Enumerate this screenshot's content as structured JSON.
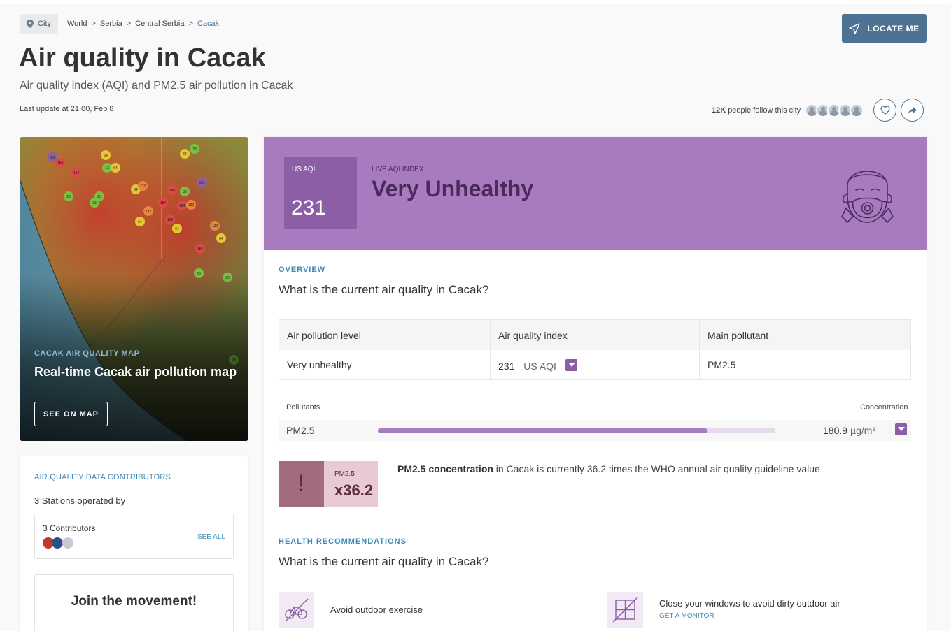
{
  "breadcrumb": {
    "city_pill": "City",
    "items": [
      "World",
      "Serbia",
      "Central Serbia",
      "Cacak"
    ],
    "separator": ">"
  },
  "locate_button": "LOCATE ME",
  "page_title": "Air quality in Cacak",
  "subtitle": "Air quality index (AQI) and PM2.5 air pollution in Cacak",
  "last_update": "Last update at 21:00, Feb 8",
  "followers": {
    "count": "12K",
    "text": "people follow this city"
  },
  "map_card": {
    "tag": "CACAK AIR QUALITY MAP",
    "title": "Real-time Cacak air pollution map",
    "button": "SEE ON MAP",
    "markers": [
      "301",
      "184",
      "184",
      "64",
      "13",
      "64",
      "64",
      "23",
      "23",
      "23",
      "33",
      "64",
      "132",
      "184",
      "132",
      "184",
      "30",
      "184",
      "132",
      "301",
      "184",
      "64",
      "64",
      "132",
      "184",
      "64",
      "23",
      "23",
      "23"
    ]
  },
  "contributors": {
    "tag": "AIR QUALITY DATA CONTRIBUTORS",
    "stations": "3 Stations operated by",
    "count": "3 Contributors",
    "see_all": "SEE ALL",
    "join": "Join the movement!"
  },
  "aqi": {
    "label": "US AQI",
    "value": "231",
    "live_label": "LIVE AQI INDEX",
    "level": "Very Unhealthy",
    "color": "#a87bbf"
  },
  "overview": {
    "tag": "OVERVIEW",
    "question": "What is the current air quality in Cacak?",
    "table": {
      "headers": [
        "Air pollution level",
        "Air quality index",
        "Main pollutant"
      ],
      "row": {
        "level": "Very unhealthy",
        "aqi": "231",
        "aqi_unit": "US AQI",
        "pollutant": "PM2.5"
      }
    }
  },
  "pollutants": {
    "header_left": "Pollutants",
    "header_right": "Concentration",
    "items": [
      {
        "name": "PM2.5",
        "value": "180.9",
        "unit": "µg/m³",
        "level": 0.83
      }
    ]
  },
  "who": {
    "mark": "!",
    "pollutant": "PM2.5",
    "multiplier": "x36.2",
    "text_bold": "PM2.5 concentration",
    "text_rest": " in Cacak is currently 36.2 times the WHO annual air quality guideline value"
  },
  "health": {
    "tag": "HEALTH RECOMMENDATIONS",
    "question": "What is the current air quality in Cacak?",
    "recommendations": [
      {
        "text": "Avoid outdoor exercise",
        "icon": "no-bike-icon"
      },
      {
        "text": "Close your windows to avoid dirty outdoor air",
        "link": "GET A MONITOR",
        "icon": "closed-window-icon"
      }
    ]
  }
}
